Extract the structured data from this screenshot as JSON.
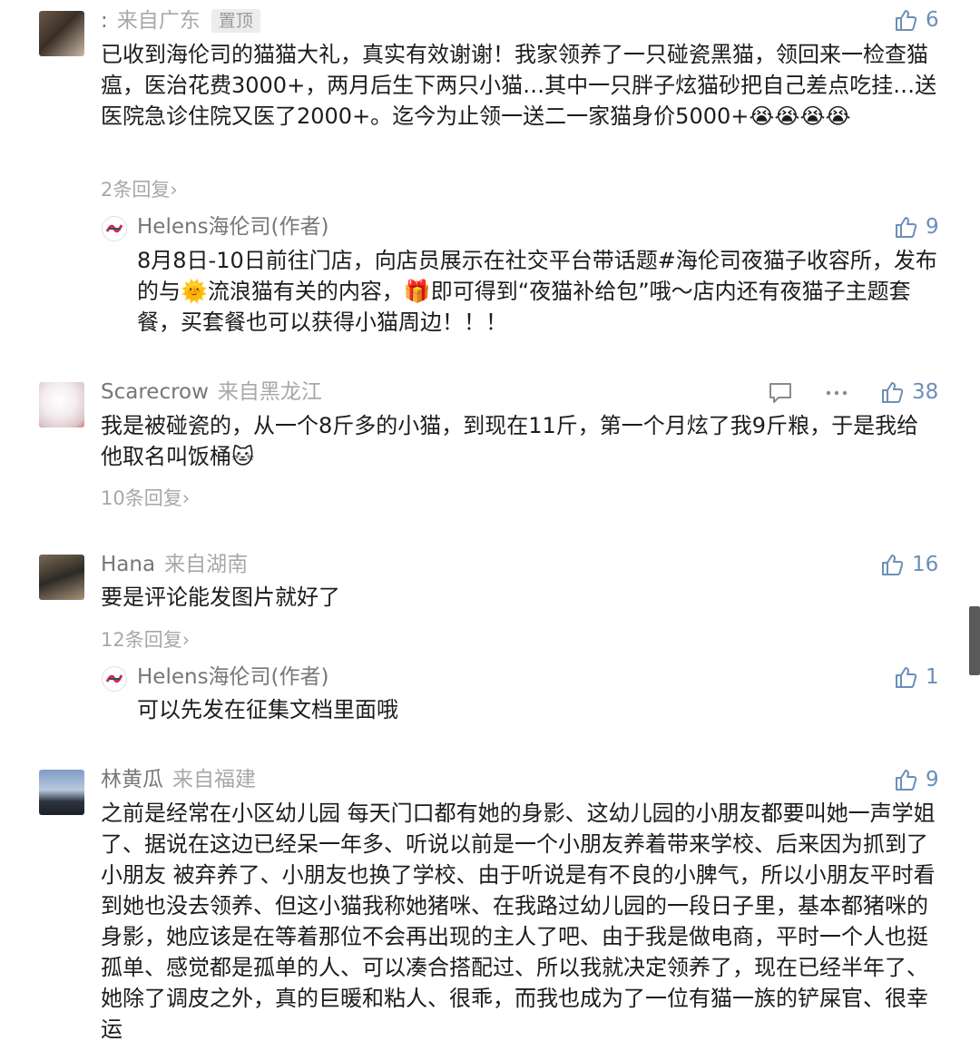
{
  "comments": [
    {
      "name": ":",
      "location": "来自广东",
      "pin": "置顶",
      "likes": "6",
      "text": "已收到海伦司的猫猫大礼，真实有效谢谢！我家领养了一只碰瓷黑猫，领回来一检查猫瘟，医治花费3000+，两月后生下两只小猫…其中一只胖子炫猫砂把自己差点吃挂…送医院急诊住院又医了2000+。迄今为止领一送二一家猫身价5000+😭😭😭😭",
      "replies": "2条回复",
      "reply": {
        "name": "Helens海伦司(作者)",
        "likes": "9",
        "text": "8月8日-10日前往门店，向店员展示在社交平台带话题#海伦司夜猫子收容所，发布的与🌞流浪猫有关的内容，🎁即可得到“夜猫补给包”哦～店内还有夜猫子主题套餐，买套餐也可以获得小猫周边！！！"
      }
    },
    {
      "name": "Scarecrow",
      "location": "来自黑龙江",
      "likes": "38",
      "text": "我是被碰瓷的，从一个8斤多的小猫，到现在11斤，第一个月炫了我9斤粮，于是我给他取名叫饭桶🐱",
      "replies": "10条回复"
    },
    {
      "name": "Hana",
      "location": "来自湖南",
      "likes": "16",
      "text": "要是评论能发图片就好了",
      "replies": "12条回复",
      "reply": {
        "name": "Helens海伦司(作者)",
        "likes": "1",
        "text": "可以先发在征集文档里面哦"
      }
    },
    {
      "name": "林黄瓜",
      "location": "来自福建",
      "likes": "9",
      "text": "之前是经常在小区幼儿园 每天门口都有她的身影、这幼儿园的小朋友都要叫她一声学姐了、据说在这边已经呆一年多、听说以前是一个小朋友养着带来学校、后来因为抓到了小朋友 被弃养了、小朋友也换了学校、由于听说是有不良的小脾气，所以小朋友平时看到她也没去领养、但这小猫我称她猪咪、在我路过幼儿园的一段日子里，基本都猪咪的身影，她应该是在等着那位不会再出现的主人了吧、由于我是做电商，平时一个人也挺孤单、感觉都是孤单的人、可以凑合搭配过、所以我就决定领养了，现在已经半年了、她除了调皮之外，真的巨暖和粘人、很乖，而我也成为了一位有猫一族的铲屎官、很幸运"
    }
  ],
  "colors": {
    "like": "#6a8fb8",
    "meta": "#777777",
    "muted": "#a8a8a8"
  },
  "icons": [
    "thumbs-up-icon",
    "comment-icon",
    "more-icon",
    "chevron-right-icon",
    "helens-logo-icon"
  ]
}
